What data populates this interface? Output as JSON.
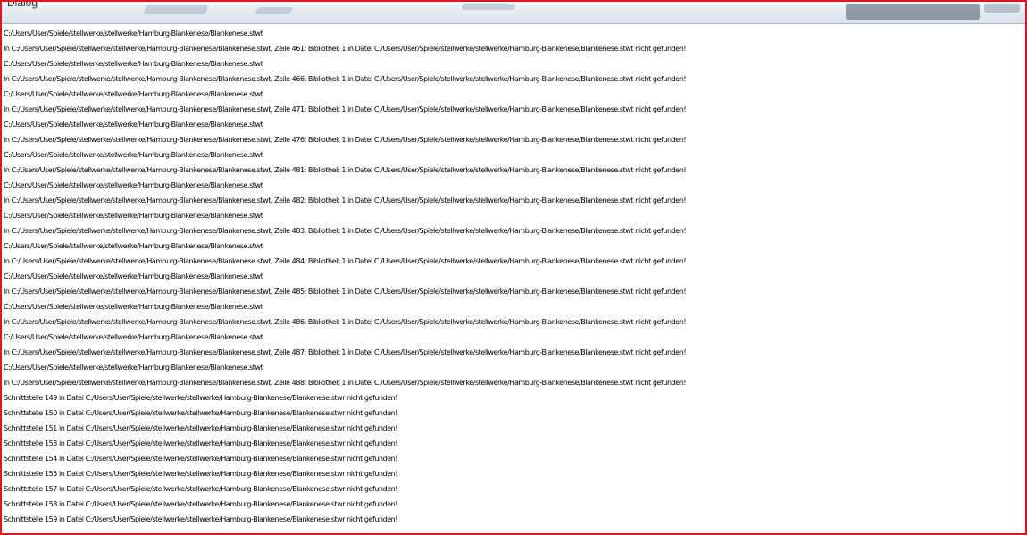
{
  "window": {
    "title": "Dialog"
  },
  "log": {
    "lines": [
      "C:/Users/User/Spiele/stellwerke/stellwerke/Hamburg-Blankenese/Blankenese.stwt",
      "In C:/Users/User/Spiele/stellwerke/stellwerke/Hamburg-Blankenese/Blankenese.stwt, Zeile 461: Bibliothek 1 in Datei C:/Users/User/Spiele/stellwerke/stellwerke/Hamburg-Blankenese/Blankenese.stwt nicht gefunden!",
      "C:/Users/User/Spiele/stellwerke/stellwerke/Hamburg-Blankenese/Blankenese.stwt",
      "In C:/Users/User/Spiele/stellwerke/stellwerke/Hamburg-Blankenese/Blankenese.stwt, Zeile 466: Bibliothek 1 in Datei C:/Users/User/Spiele/stellwerke/stellwerke/Hamburg-Blankenese/Blankenese.stwt nicht gefunden!",
      "C:/Users/User/Spiele/stellwerke/stellwerke/Hamburg-Blankenese/Blankenese.stwt",
      "In C:/Users/User/Spiele/stellwerke/stellwerke/Hamburg-Blankenese/Blankenese.stwt, Zeile 471: Bibliothek 1 in Datei C:/Users/User/Spiele/stellwerke/stellwerke/Hamburg-Blankenese/Blankenese.stwt nicht gefunden!",
      "C:/Users/User/Spiele/stellwerke/stellwerke/Hamburg-Blankenese/Blankenese.stwt",
      "In C:/Users/User/Spiele/stellwerke/stellwerke/Hamburg-Blankenese/Blankenese.stwt, Zeile 476: Bibliothek 1 in Datei C:/Users/User/Spiele/stellwerke/stellwerke/Hamburg-Blankenese/Blankenese.stwt nicht gefunden!",
      "C:/Users/User/Spiele/stellwerke/stellwerke/Hamburg-Blankenese/Blankenese.stwt",
      "In C:/Users/User/Spiele/stellwerke/stellwerke/Hamburg-Blankenese/Blankenese.stwt, Zeile 481: Bibliothek 1 in Datei C:/Users/User/Spiele/stellwerke/stellwerke/Hamburg-Blankenese/Blankenese.stwt nicht gefunden!",
      "C:/Users/User/Spiele/stellwerke/stellwerke/Hamburg-Blankenese/Blankenese.stwt",
      "In C:/Users/User/Spiele/stellwerke/stellwerke/Hamburg-Blankenese/Blankenese.stwt, Zeile 482: Bibliothek 1 in Datei C:/Users/User/Spiele/stellwerke/stellwerke/Hamburg-Blankenese/Blankenese.stwt nicht gefunden!",
      "C:/Users/User/Spiele/stellwerke/stellwerke/Hamburg-Blankenese/Blankenese.stwt",
      "In C:/Users/User/Spiele/stellwerke/stellwerke/Hamburg-Blankenese/Blankenese.stwt, Zeile 483: Bibliothek 1 in Datei C:/Users/User/Spiele/stellwerke/stellwerke/Hamburg-Blankenese/Blankenese.stwt nicht gefunden!",
      "C:/Users/User/Spiele/stellwerke/stellwerke/Hamburg-Blankenese/Blankenese.stwt",
      "In C:/Users/User/Spiele/stellwerke/stellwerke/Hamburg-Blankenese/Blankenese.stwt, Zeile 484: Bibliothek 1 in Datei C:/Users/User/Spiele/stellwerke/stellwerke/Hamburg-Blankenese/Blankenese.stwt nicht gefunden!",
      "C:/Users/User/Spiele/stellwerke/stellwerke/Hamburg-Blankenese/Blankenese.stwt",
      "In C:/Users/User/Spiele/stellwerke/stellwerke/Hamburg-Blankenese/Blankenese.stwt, Zeile 485: Bibliothek 1 in Datei C:/Users/User/Spiele/stellwerke/stellwerke/Hamburg-Blankenese/Blankenese.stwt nicht gefunden!",
      "C:/Users/User/Spiele/stellwerke/stellwerke/Hamburg-Blankenese/Blankenese.stwt",
      "In C:/Users/User/Spiele/stellwerke/stellwerke/Hamburg-Blankenese/Blankenese.stwt, Zeile 486: Bibliothek 1 in Datei C:/Users/User/Spiele/stellwerke/stellwerke/Hamburg-Blankenese/Blankenese.stwt nicht gefunden!",
      "C:/Users/User/Spiele/stellwerke/stellwerke/Hamburg-Blankenese/Blankenese.stwt",
      "In C:/Users/User/Spiele/stellwerke/stellwerke/Hamburg-Blankenese/Blankenese.stwt, Zeile 487: Bibliothek 1 in Datei C:/Users/User/Spiele/stellwerke/stellwerke/Hamburg-Blankenese/Blankenese.stwt nicht gefunden!",
      "C:/Users/User/Spiele/stellwerke/stellwerke/Hamburg-Blankenese/Blankenese.stwt",
      "In C:/Users/User/Spiele/stellwerke/stellwerke/Hamburg-Blankenese/Blankenese.stwt, Zeile 488: Bibliothek 1 in Datei C:/Users/User/Spiele/stellwerke/stellwerke/Hamburg-Blankenese/Blankenese.stwt nicht gefunden!",
      "Schnittstelle 149 in Datei C:/Users/User/Spiele/stellwerke/stellwerke/Hamburg-Blankenese/Blankenese.stwr nicht gefunden!",
      "Schnittstelle 150 in Datei C:/Users/User/Spiele/stellwerke/stellwerke/Hamburg-Blankenese/Blankenese.stwr nicht gefunden!",
      "Schnittstelle 151 in Datei C:/Users/User/Spiele/stellwerke/stellwerke/Hamburg-Blankenese/Blankenese.stwr nicht gefunden!",
      "Schnittstelle 153 in Datei C:/Users/User/Spiele/stellwerke/stellwerke/Hamburg-Blankenese/Blankenese.stwr nicht gefunden!",
      "Schnittstelle 154 in Datei C:/Users/User/Spiele/stellwerke/stellwerke/Hamburg-Blankenese/Blankenese.stwr nicht gefunden!",
      "Schnittstelle 155 in Datei C:/Users/User/Spiele/stellwerke/stellwerke/Hamburg-Blankenese/Blankenese.stwr nicht gefunden!",
      "Schnittstelle 157 in Datei C:/Users/User/Spiele/stellwerke/stellwerke/Hamburg-Blankenese/Blankenese.stwr nicht gefunden!",
      "Schnittstelle 158 in Datei C:/Users/User/Spiele/stellwerke/stellwerke/Hamburg-Blankenese/Blankenese.stwr nicht gefunden!",
      "Schnittstelle 159 in Datei C:/Users/User/Spiele/stellwerke/stellwerke/Hamburg-Blankenese/Blankenese.stwr nicht gefunden!"
    ]
  },
  "colors": {
    "frame_border": "#e0161b",
    "background": "#ffffff",
    "text": "#000000"
  }
}
